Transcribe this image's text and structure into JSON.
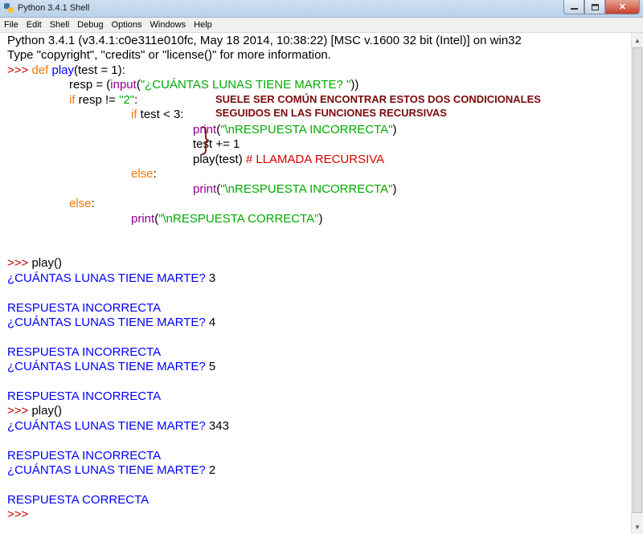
{
  "window": {
    "title": "Python 3.4.1 Shell",
    "close_glyph": "✕"
  },
  "menubar": {
    "items": [
      "File",
      "Edit",
      "Shell",
      "Debug",
      "Options",
      "Windows",
      "Help"
    ]
  },
  "header": {
    "line1": "Python 3.4.1 (v3.4.1:c0e311e010fc, May 18 2014, 10:38:22) [MSC v.1600 32 bit (Intel)] on win32",
    "line2": "Type \"copyright\", \"credits\" or \"license()\" for more information."
  },
  "code": {
    "prompt": ">>> ",
    "def_kw": "def ",
    "fn_name": "play",
    "def_rest": "(test = 1):",
    "resp_assign": "resp = (",
    "input_fn": "input",
    "paren_open": "(",
    "input_str": "\"¿CUÁNTAS LUNAS TIENE MARTE? \"",
    "paren_close2": "))",
    "if_kw": "if ",
    "if_cond": "resp != ",
    "if_str": "\"2\"",
    "colon": ":",
    "if2_kw": "if ",
    "if2_cond": "test < 3:",
    "print_fn": "print",
    "incorrect_str": "\"\\nRESPUESTA INCORRECTA\"",
    "paren_close": ")",
    "test_inc": "test += 1",
    "recursive_call": "play(test) ",
    "comment": "# LLAMADA RECURSIVA",
    "else_kw": "else",
    "correct_str": "\"\\nRESPUESTA CORRECTA\""
  },
  "annotation": {
    "line1": "SUELE SER COMÚN ENCONTRAR ESTOS DOS CONDICIONALES",
    "line2": "SEGUIDOS EN LAS FUNCIONES RECURSIVAS"
  },
  "session": {
    "call": "play()",
    "question": "¿CUÁNTAS LUNAS TIENE MARTE? ",
    "answer1": "3",
    "answer2": "4",
    "answer3": "5",
    "answer4": "343",
    "answer5": "2",
    "incorrect": "RESPUESTA INCORRECTA",
    "correct": "RESPUESTA CORRECTA",
    "final_prompt": ">>>"
  },
  "icons": {
    "app": "python-logo-icon",
    "minimize": "minimize-icon",
    "maximize": "maximize-icon",
    "close": "close-icon"
  }
}
